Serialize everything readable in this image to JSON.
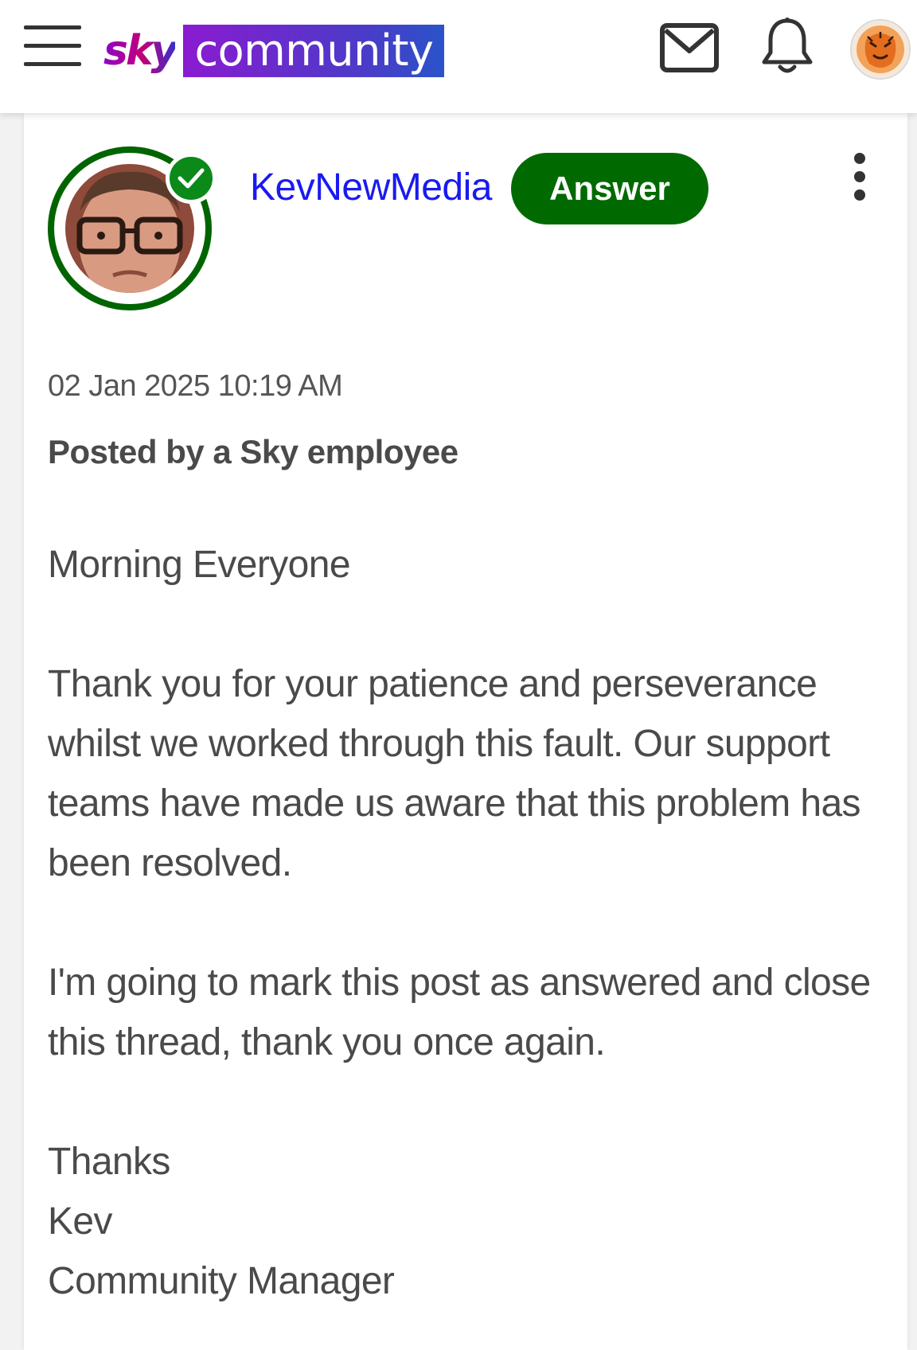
{
  "header": {
    "logo_sky": "sky",
    "logo_community": "community"
  },
  "post": {
    "author": "KevNewMedia",
    "badge": "Answer",
    "date": "02 Jan 2025 10:19 AM",
    "posted_by": "Posted by a Sky employee",
    "greeting": "Morning Everyone",
    "paragraph1": "Thank you for your patience and perseverance whilst we worked through this fault. Our support teams have made us aware that this problem has been resolved.",
    "paragraph2": "I'm going to mark this post as answered and close this thread, thank you once again.",
    "sign_thanks": "Thanks",
    "sign_name": "Kev",
    "sign_title": "Community Manager"
  },
  "colors": {
    "accent_green": "#006a00",
    "online_green": "#0b8a1a",
    "link_blue": "#1a1af0",
    "brand_purple": "#8a1bd0"
  },
  "icons": [
    "menu-icon",
    "mail-icon",
    "bell-icon",
    "user-avatar",
    "check-icon",
    "more-vertical-icon"
  ]
}
